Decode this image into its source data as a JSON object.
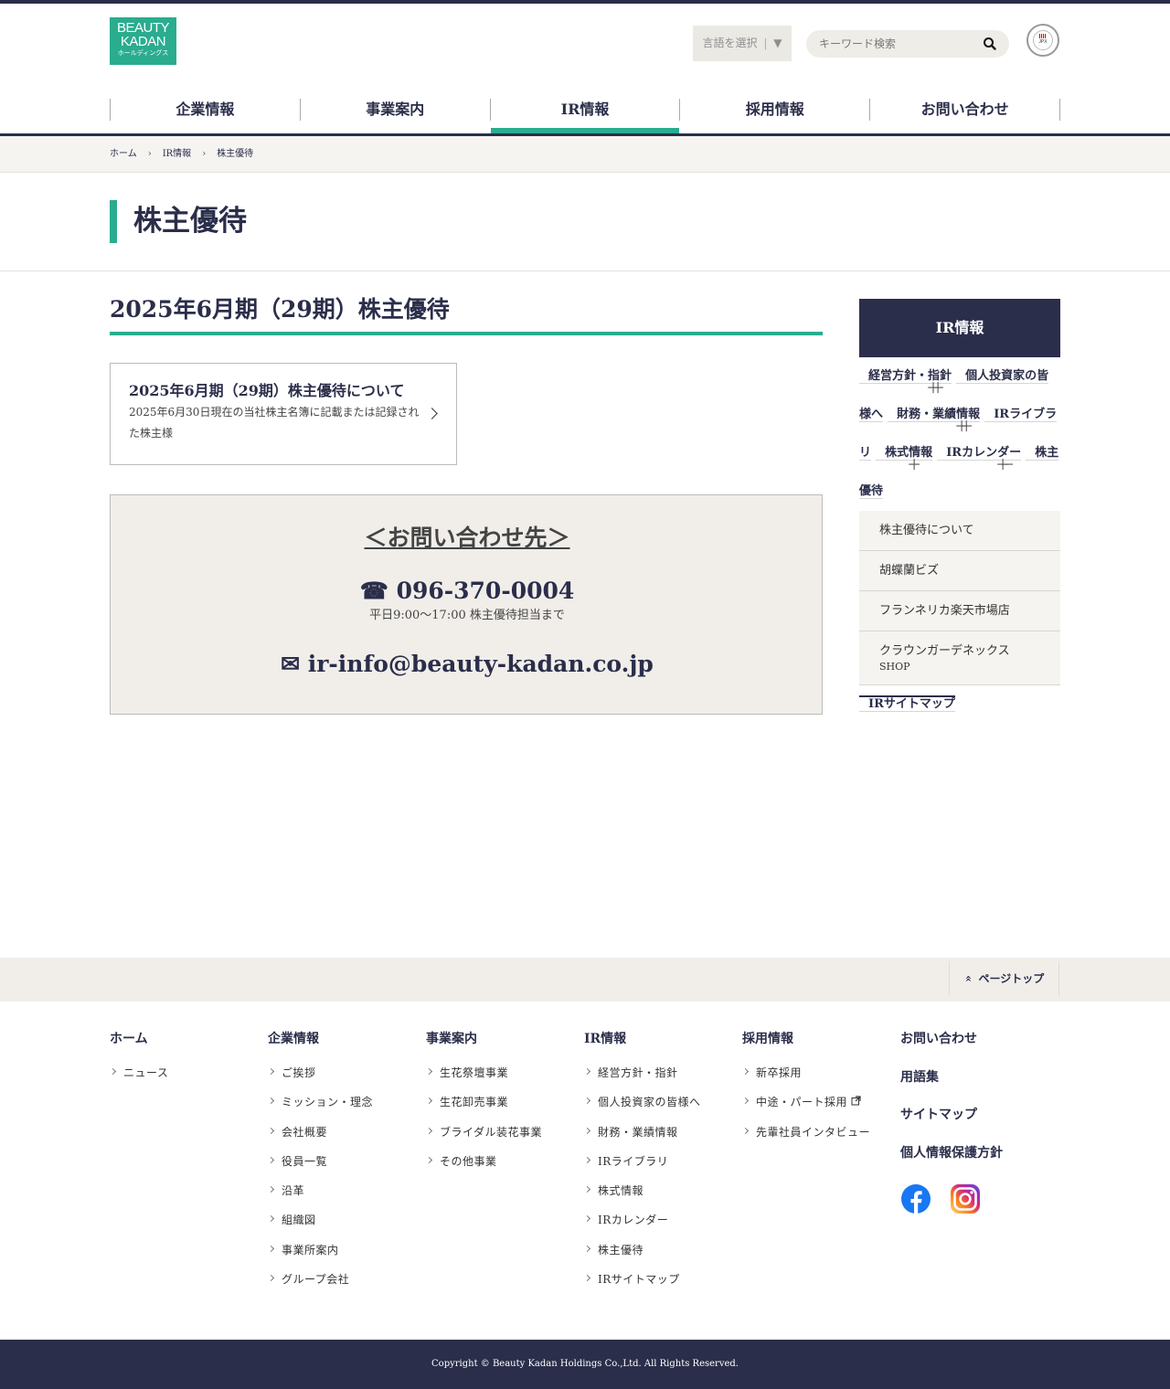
{
  "logo": {
    "line1": "BEAUTY",
    "line2": "KADAN",
    "line3": "ホールディングス"
  },
  "header": {
    "lang_label": "言語を選択",
    "lang_arrow": "▼",
    "search_placeholder": "キーワード検索",
    "jpx_text": "JPX"
  },
  "gnav": [
    {
      "label": "企業情報",
      "active": false
    },
    {
      "label": "事業案内",
      "active": false
    },
    {
      "label": "IR情報",
      "active": true
    },
    {
      "label": "採用情報",
      "active": false
    },
    {
      "label": "お問い合わせ",
      "active": false
    }
  ],
  "breadcrumb": [
    "ホーム",
    "IR情報",
    "株主優待"
  ],
  "page_title": "株主優待",
  "main": {
    "h2": "2025年6月期（29期）株主優待",
    "card": {
      "title": "2025年6月期（29期）株主優待について",
      "desc": "2025年6月30日現在の当社株主名簿に記載または記録された株主様"
    },
    "contact": {
      "heading": "＜お問い合わせ先＞",
      "tel_icon": "☎",
      "tel": "096-370-0004",
      "hours": "平日9:00～17:00 株主優待担当まで",
      "mail_icon": "✉",
      "mail": "ir-info@beauty-kadan.co.jp"
    }
  },
  "sidebar": {
    "head": "IR情報",
    "items": [
      {
        "label": "経営方針・指針",
        "sign": "＋"
      },
      {
        "label": "個人投資家の皆様へ",
        "sign": "＋"
      },
      {
        "label": "財務・業績情報",
        "sign": "＋"
      },
      {
        "label": "IRライブラリ",
        "sign": "＋"
      },
      {
        "label": "株式情報",
        "sign": "＋"
      },
      {
        "label": "IRカレンダー",
        "sign": "＋"
      },
      {
        "label": "株主優待",
        "sign": "－"
      }
    ],
    "subs": [
      "株主優待について",
      "胡蝶蘭ビズ",
      "フランネリカ楽天市場店"
    ],
    "sub_two": {
      "line1": "クラウンガーデネックス",
      "line2": "SHOP"
    },
    "last": "IRサイトマップ"
  },
  "pagetop": {
    "icon": "»",
    "label": "ページトップ"
  },
  "footer_nav": {
    "home": {
      "head": "ホーム",
      "items": [
        "ニュース"
      ]
    },
    "company": {
      "head": "企業情報",
      "items": [
        "ご挨拶",
        "ミッション・理念",
        "会社概要",
        "役員一覧",
        "沿革",
        "組織図",
        "事業所案内",
        "グループ会社"
      ]
    },
    "business": {
      "head": "事業案内",
      "items": [
        "生花祭壇事業",
        "生花卸売事業",
        "ブライダル装花事業",
        "その他事業"
      ]
    },
    "ir": {
      "head": "IR情報",
      "items": [
        "経営方針・指針",
        "個人投資家の皆様へ",
        "財務・業績情報",
        "IRライブラリ",
        "株式情報",
        "IRカレンダー",
        "株主優待",
        "IRサイトマップ"
      ]
    },
    "recruit": {
      "head": "採用情報",
      "items": [
        "新卒採用",
        "中途・パート採用",
        "先輩社員インタビュー"
      ]
    },
    "misc": [
      "お問い合わせ",
      "用語集",
      "サイトマップ",
      "個人情報保護方針"
    ]
  },
  "copyright": "Copyright © Beauty Kadan Holdings Co.,Ltd. All Rights Reserved.",
  "colors": {
    "navy": "#2b2e4a",
    "green": "#2aac8f",
    "beige": "#f1eeea"
  }
}
